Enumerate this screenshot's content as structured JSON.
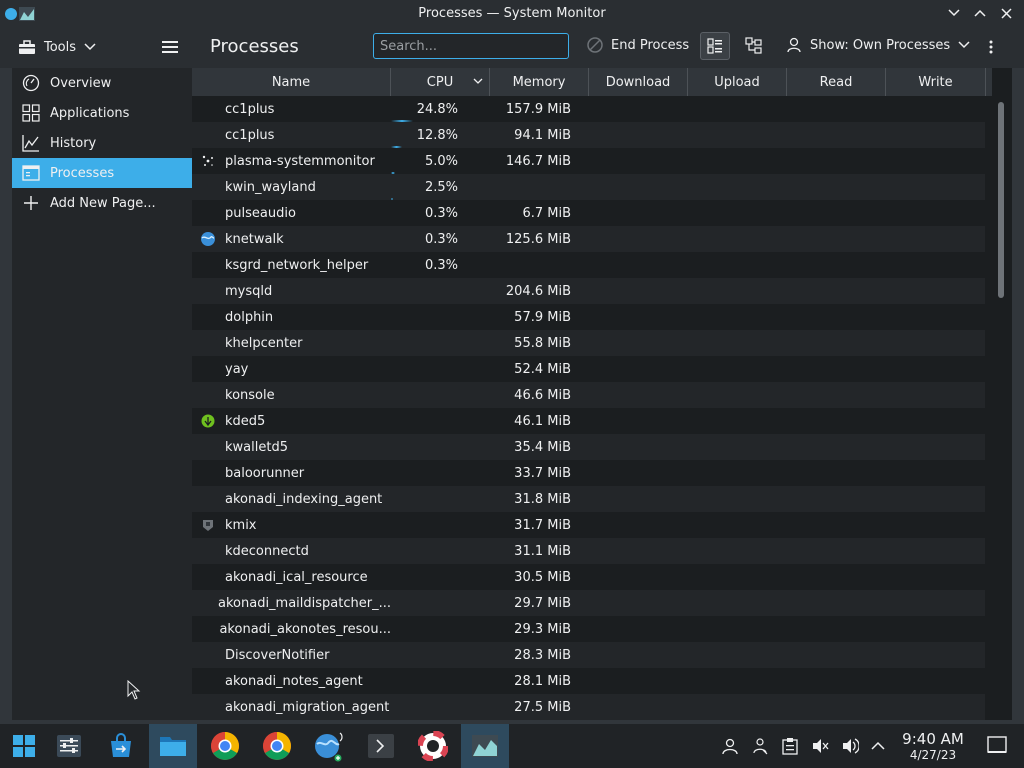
{
  "window": {
    "title": "Processes — System Monitor"
  },
  "toolbar": {
    "tools_label": "Tools",
    "page_title": "Processes",
    "search_placeholder": "Search...",
    "end_process_label": "End Process",
    "show_label": "Show: Own Processes"
  },
  "sidebar": {
    "items": [
      {
        "label": "Overview",
        "icon": "overview-icon"
      },
      {
        "label": "Applications",
        "icon": "applications-icon"
      },
      {
        "label": "History",
        "icon": "history-icon"
      },
      {
        "label": "Processes",
        "icon": "processes-icon",
        "active": true
      },
      {
        "label": "Add New Page...",
        "icon": "plus-icon"
      }
    ]
  },
  "table": {
    "columns": [
      "Name",
      "CPU",
      "Memory",
      "Download",
      "Upload",
      "Read",
      "Write"
    ],
    "sorted_column": "CPU",
    "rows": [
      {
        "name": "cc1plus",
        "cpu": "24.8%",
        "memory": "157.9 MiB",
        "icon": ""
      },
      {
        "name": "cc1plus",
        "cpu": "12.8%",
        "memory": "94.1 MiB",
        "icon": ""
      },
      {
        "name": "plasma-systemmonitor",
        "cpu": "5.0%",
        "memory": "146.7 MiB",
        "icon": "sparkle-icon"
      },
      {
        "name": "kwin_wayland",
        "cpu": "2.5%",
        "memory": "",
        "icon": ""
      },
      {
        "name": "pulseaudio",
        "cpu": "0.3%",
        "memory": "6.7 MiB",
        "icon": ""
      },
      {
        "name": "knetwalk",
        "cpu": "0.3%",
        "memory": "125.6 MiB",
        "icon": "globe-icon"
      },
      {
        "name": "ksgrd_network_helper",
        "cpu": "0.3%",
        "memory": "",
        "icon": ""
      },
      {
        "name": "mysqld",
        "cpu": "",
        "memory": "204.6 MiB",
        "icon": ""
      },
      {
        "name": "dolphin",
        "cpu": "",
        "memory": "57.9 MiB",
        "icon": ""
      },
      {
        "name": "khelpcenter",
        "cpu": "",
        "memory": "55.8 MiB",
        "icon": ""
      },
      {
        "name": "yay",
        "cpu": "",
        "memory": "52.4 MiB",
        "icon": ""
      },
      {
        "name": "konsole",
        "cpu": "",
        "memory": "46.6 MiB",
        "icon": ""
      },
      {
        "name": "kded5",
        "cpu": "",
        "memory": "46.1 MiB",
        "icon": "green-check-icon"
      },
      {
        "name": "kwalletd5",
        "cpu": "",
        "memory": "35.4 MiB",
        "icon": ""
      },
      {
        "name": "baloorunner",
        "cpu": "",
        "memory": "33.7 MiB",
        "icon": ""
      },
      {
        "name": "akonadi_indexing_agent",
        "cpu": "",
        "memory": "31.8 MiB",
        "icon": ""
      },
      {
        "name": "kmix",
        "cpu": "",
        "memory": "31.7 MiB",
        "icon": "mixer-icon"
      },
      {
        "name": "kdeconnectd",
        "cpu": "",
        "memory": "31.1 MiB",
        "icon": ""
      },
      {
        "name": "akonadi_ical_resource",
        "cpu": "",
        "memory": "30.5 MiB",
        "icon": ""
      },
      {
        "name": "akonadi_maildispatcher_...",
        "cpu": "",
        "memory": "29.7 MiB",
        "icon": ""
      },
      {
        "name": "akonadi_akonotes_resou...",
        "cpu": "",
        "memory": "29.3 MiB",
        "icon": ""
      },
      {
        "name": "DiscoverNotifier",
        "cpu": "",
        "memory": "28.3 MiB",
        "icon": ""
      },
      {
        "name": "akonadi_notes_agent",
        "cpu": "",
        "memory": "28.1 MiB",
        "icon": ""
      },
      {
        "name": "akonadi_migration_agent",
        "cpu": "",
        "memory": "27.5 MiB",
        "icon": ""
      }
    ]
  },
  "taskbar": {
    "items": [
      "start-menu-icon",
      "settings-icon",
      "discover-store-icon",
      "file-manager-icon",
      "chrome-icon",
      "chrome-icon",
      "kdeconnect-icon",
      "terminal-icon",
      "help-center-icon",
      "system-monitor-icon"
    ],
    "clock_time": "9:40 AM",
    "clock_date": "4/27/23"
  },
  "colors": {
    "accent": "#3daee9",
    "window_bg": "#31363b",
    "view_bg": "#1b1e20"
  }
}
